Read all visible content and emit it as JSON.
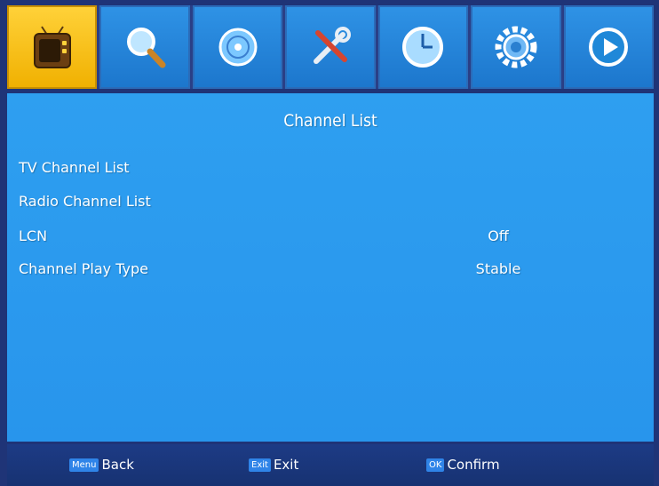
{
  "menu_icons": [
    {
      "name": "tv-icon",
      "active": true
    },
    {
      "name": "search-icon",
      "active": false
    },
    {
      "name": "disc-icon",
      "active": false
    },
    {
      "name": "tools-icon",
      "active": false
    },
    {
      "name": "clock-icon",
      "active": false
    },
    {
      "name": "gear-icon",
      "active": false
    },
    {
      "name": "play-icon",
      "active": false
    }
  ],
  "colors": {
    "active_tile": "#f7c21b",
    "tile": "#2585de",
    "panel": "#2b9af0",
    "footer": "#1b367b",
    "key_badge": "#2f84e8"
  },
  "panel": {
    "title": "Channel List",
    "rows": [
      {
        "label": "TV Channel List",
        "value": ""
      },
      {
        "label": "Radio Channel List",
        "value": ""
      },
      {
        "label": "LCN",
        "value": "Off"
      },
      {
        "label": "Channel Play Type",
        "value": "Stable"
      }
    ]
  },
  "footer": {
    "hints": [
      {
        "key": "Menu",
        "label": "Back"
      },
      {
        "key": "Exit",
        "label": "Exit"
      },
      {
        "key": "OK",
        "label": "Confirm"
      }
    ]
  }
}
